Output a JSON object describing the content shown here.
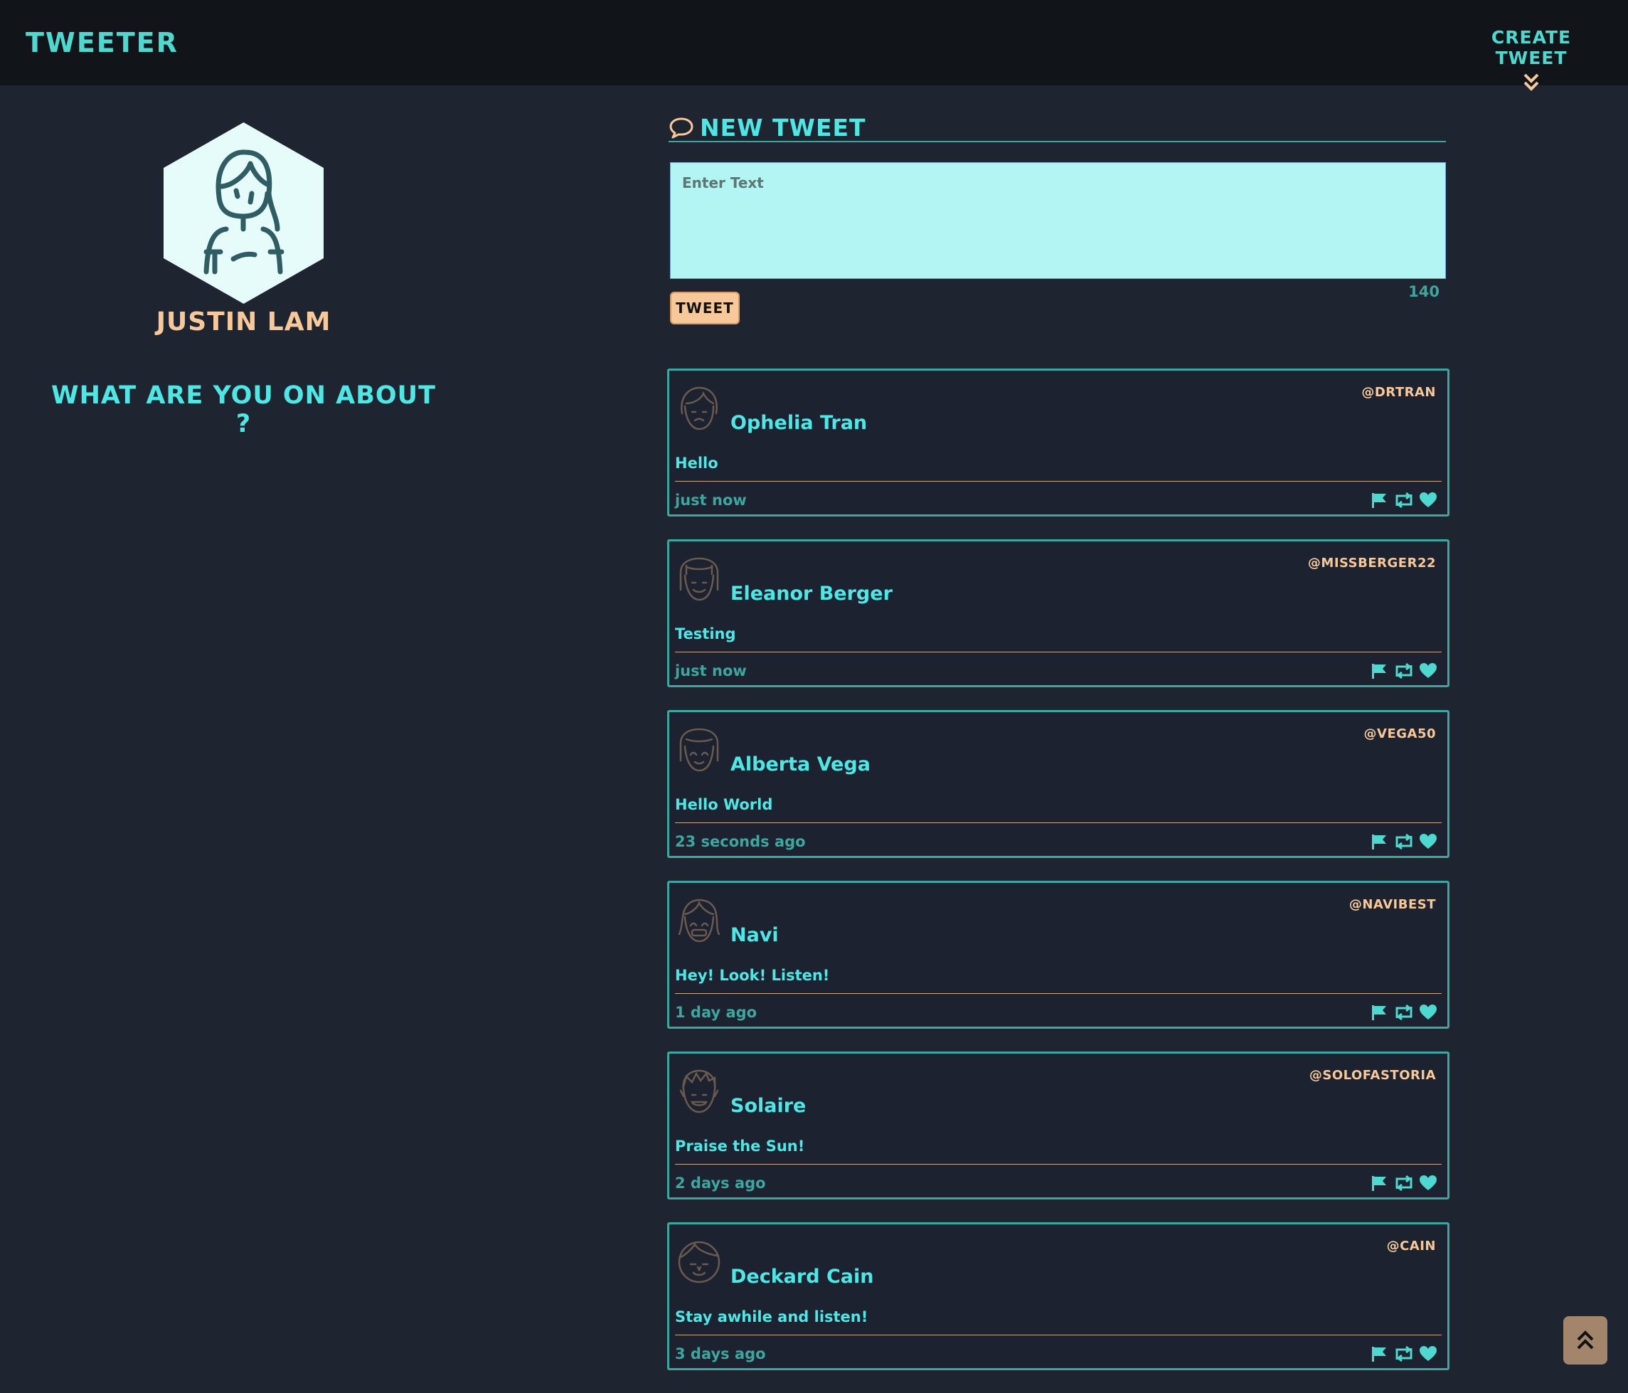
{
  "nav": {
    "brand": "Tweeter",
    "create_label": "Create Tweet"
  },
  "profile": {
    "name": "Justin Lam",
    "tagline": "What are you on about ?"
  },
  "compose": {
    "title": "New Tweet",
    "placeholder": "Enter Text",
    "button_label": "Tweet",
    "counter": "140"
  },
  "tweets": [
    {
      "name": "Ophelia Tran",
      "handle": "@drtran",
      "content": "Hello",
      "time": "just now"
    },
    {
      "name": "Eleanor Berger",
      "handle": "@missberger22",
      "content": "Testing",
      "time": "just now"
    },
    {
      "name": "Alberta Vega",
      "handle": "@vega50",
      "content": "Hello World",
      "time": "23 seconds ago"
    },
    {
      "name": "Navi",
      "handle": "@navibest",
      "content": "Hey! Look! Listen!",
      "time": "1 day ago"
    },
    {
      "name": "Solaire",
      "handle": "@solofastoria",
      "content": "Praise the Sun!",
      "time": "2 days ago"
    },
    {
      "name": "Deckard Cain",
      "handle": "@cain",
      "content": "Stay awhile and listen!",
      "time": "3 days ago"
    }
  ],
  "icons": {
    "create_chevron": "double-chevron-down-icon",
    "compose": "speech-bubble-icon",
    "flag": "flag-icon",
    "retweet": "retweet-icon",
    "like": "heart-icon",
    "scroll_top": "double-chevron-up-icon"
  },
  "colors": {
    "accent": "#4fe6e6",
    "teal": "#3ea6a0",
    "peach": "#f7c89a",
    "background": "#1e2430",
    "input_bg": "#b2f5f3"
  }
}
